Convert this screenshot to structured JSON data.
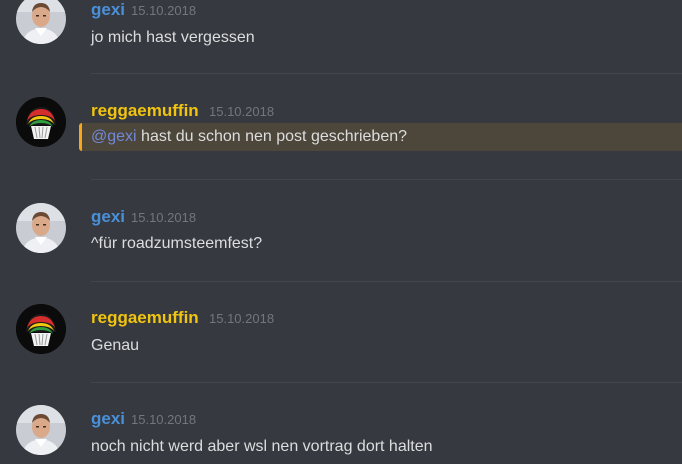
{
  "colors": {
    "background": "#36393f",
    "gexi_name": "#4a90d9",
    "reggaemuffin_name": "#f1c40f",
    "mention_highlight": "#faa61a",
    "mention_text": "#7289da"
  },
  "messages": [
    {
      "author": "gexi",
      "timestamp": "15.10.2018",
      "text": "jo mich hast vergessen",
      "avatar_icon": "man-portrait-icon"
    },
    {
      "author": "reggaemuffin",
      "timestamp": "15.10.2018",
      "mention": "@gexi",
      "text": " hast du schon nen post geschrieben?",
      "avatar_icon": "rasta-muffin-icon"
    },
    {
      "author": "gexi",
      "timestamp": "15.10.2018",
      "text": "^für roadzumsteemfest?",
      "avatar_icon": "man-portrait-icon"
    },
    {
      "author": "reggaemuffin",
      "timestamp": "15.10.2018",
      "text": "Genau",
      "avatar_icon": "rasta-muffin-icon"
    },
    {
      "author": "gexi",
      "timestamp": "15.10.2018",
      "text": "noch nicht werd aber wsl nen vortrag dort halten",
      "avatar_icon": "man-portrait-icon"
    }
  ]
}
